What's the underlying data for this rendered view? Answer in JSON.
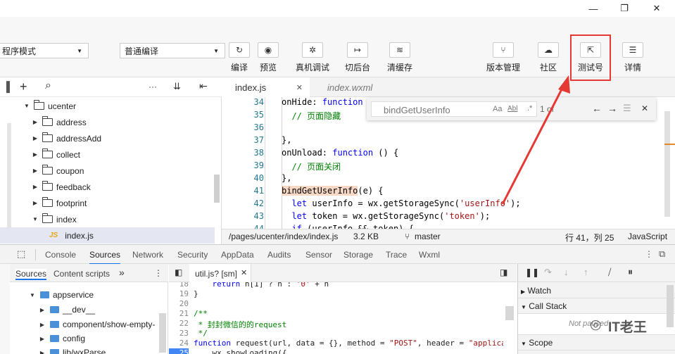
{
  "titlebar": {
    "minimize_glyph": "—",
    "restore_glyph": "❐",
    "close_glyph": "✕"
  },
  "toolbar": {
    "mode_select": "程序模式",
    "compile_select": "普通编译",
    "buttons": [
      {
        "label": "编译",
        "glyph": "↻"
      },
      {
        "label": "预览",
        "glyph": "◉"
      },
      {
        "label": "真机调试",
        "glyph": "✲"
      },
      {
        "label": "切后台",
        "glyph": "↦"
      },
      {
        "label": "清缓存",
        "glyph": "≋"
      }
    ],
    "right_buttons": [
      {
        "label": "版本管理",
        "glyph": "⑂"
      },
      {
        "label": "社区",
        "glyph": "☁"
      },
      {
        "label": "测试号",
        "glyph": "⇱"
      },
      {
        "label": "详情",
        "glyph": "☰"
      }
    ]
  },
  "explorer": {
    "toolbar": {
      "add": "+",
      "search": "⌕",
      "more": "···",
      "collapse": "⇤"
    },
    "items": [
      {
        "label": "ucenter",
        "expanded": true,
        "type": "folder"
      },
      {
        "label": "address",
        "expanded": false,
        "type": "folder"
      },
      {
        "label": "addressAdd",
        "expanded": false,
        "type": "folder"
      },
      {
        "label": "collect",
        "expanded": false,
        "type": "folder"
      },
      {
        "label": "coupon",
        "expanded": false,
        "type": "folder"
      },
      {
        "label": "feedback",
        "expanded": false,
        "type": "folder"
      },
      {
        "label": "footprint",
        "expanded": false,
        "type": "folder"
      },
      {
        "label": "index",
        "expanded": true,
        "type": "folder"
      },
      {
        "label": "index.js",
        "type": "file",
        "badge": "JS"
      }
    ]
  },
  "editor": {
    "tabs": [
      {
        "label": "index.js",
        "close": "✕",
        "active": true
      },
      {
        "label": "index.wxml",
        "active": false
      }
    ],
    "find": {
      "query": "bindGetUserInfo",
      "opt_case": "Aa",
      "opt_word": "Abl",
      "opt_regex": ".*",
      "count": "1 of",
      "prev": "←",
      "next": "→",
      "close": "✕"
    },
    "lines": [
      {
        "n": "34",
        "html": "onHide: <span class=\"kw\">function</span> ("
      },
      {
        "n": "35",
        "html": "  <span class=\"cm\">// 页面隐藏</span>"
      },
      {
        "n": "36",
        "html": ""
      },
      {
        "n": "37",
        "html": "},"
      },
      {
        "n": "38",
        "html": "onUnload: <span class=\"kw\">function</span> () {"
      },
      {
        "n": "39",
        "html": "  <span class=\"cm\">// 页面关闭</span>"
      },
      {
        "n": "40",
        "html": "},"
      },
      {
        "n": "41",
        "html": "<span class=\"hl\">bindGetUserInfo</span>(e) {"
      },
      {
        "n": "42",
        "html": "  <span class=\"kw\">let</span> userInfo = wx.getStorageSync(<span class=\"st\">'userInfo'</span>);"
      },
      {
        "n": "43",
        "html": "  <span class=\"kw\">let</span> token = wx.getStorageSync(<span class=\"st\">'token'</span>);"
      },
      {
        "n": "44",
        "html": "  <span class=\"kw\">if</span> (userInfo && token) {"
      }
    ],
    "status": {
      "path": "/pages/ucenter/index/index.js",
      "size": "3.2 KB",
      "branch": "master",
      "position": "行 41，列 25",
      "language": "JavaScript"
    }
  },
  "devtools": {
    "tabs": [
      "Console",
      "Sources",
      "Network",
      "Security",
      "AppData",
      "Audits",
      "Sensor",
      "Storage",
      "Trace",
      "Wxml"
    ],
    "active_tab": "Sources",
    "left_tabs": [
      "Sources",
      "Content scripts"
    ],
    "left_more": "»",
    "left_items": [
      {
        "label": "appservice",
        "expanded": true
      },
      {
        "label": "__dev__",
        "expanded": false
      },
      {
        "label": "component/show-empty-",
        "expanded": false
      },
      {
        "label": "config",
        "expanded": false
      },
      {
        "label": "lib/wxParse",
        "expanded": false
      }
    ],
    "file_tab": "util.js? [sm]",
    "code": [
      {
        "n": "18",
        "html": "    <span class=\"kw\">return</span> n[1] ? n : <span class=\"st\">'0'</span> + n"
      },
      {
        "n": "19",
        "html": "}"
      },
      {
        "n": "20",
        "html": ""
      },
      {
        "n": "21",
        "html": "<span class=\"cm\">/**</span>"
      },
      {
        "n": "22",
        "html": "<span class=\"cm\"> * 封封微信的的request</span>"
      },
      {
        "n": "23",
        "html": "<span class=\"cm\"> */</span>"
      },
      {
        "n": "24",
        "html": "<span class=\"kw\">function</span> request(url, data = {}, method = <span class=\"st\">\"POST\"</span>, header = <span class=\"st\">\"applica</span>"
      },
      {
        "n": "25",
        "html": "    wx.showLoading({"
      }
    ],
    "right_sections": [
      "Watch",
      "Call Stack",
      "Scope"
    ],
    "callstack_note": "Not paused",
    "watermark": "IT老王"
  }
}
